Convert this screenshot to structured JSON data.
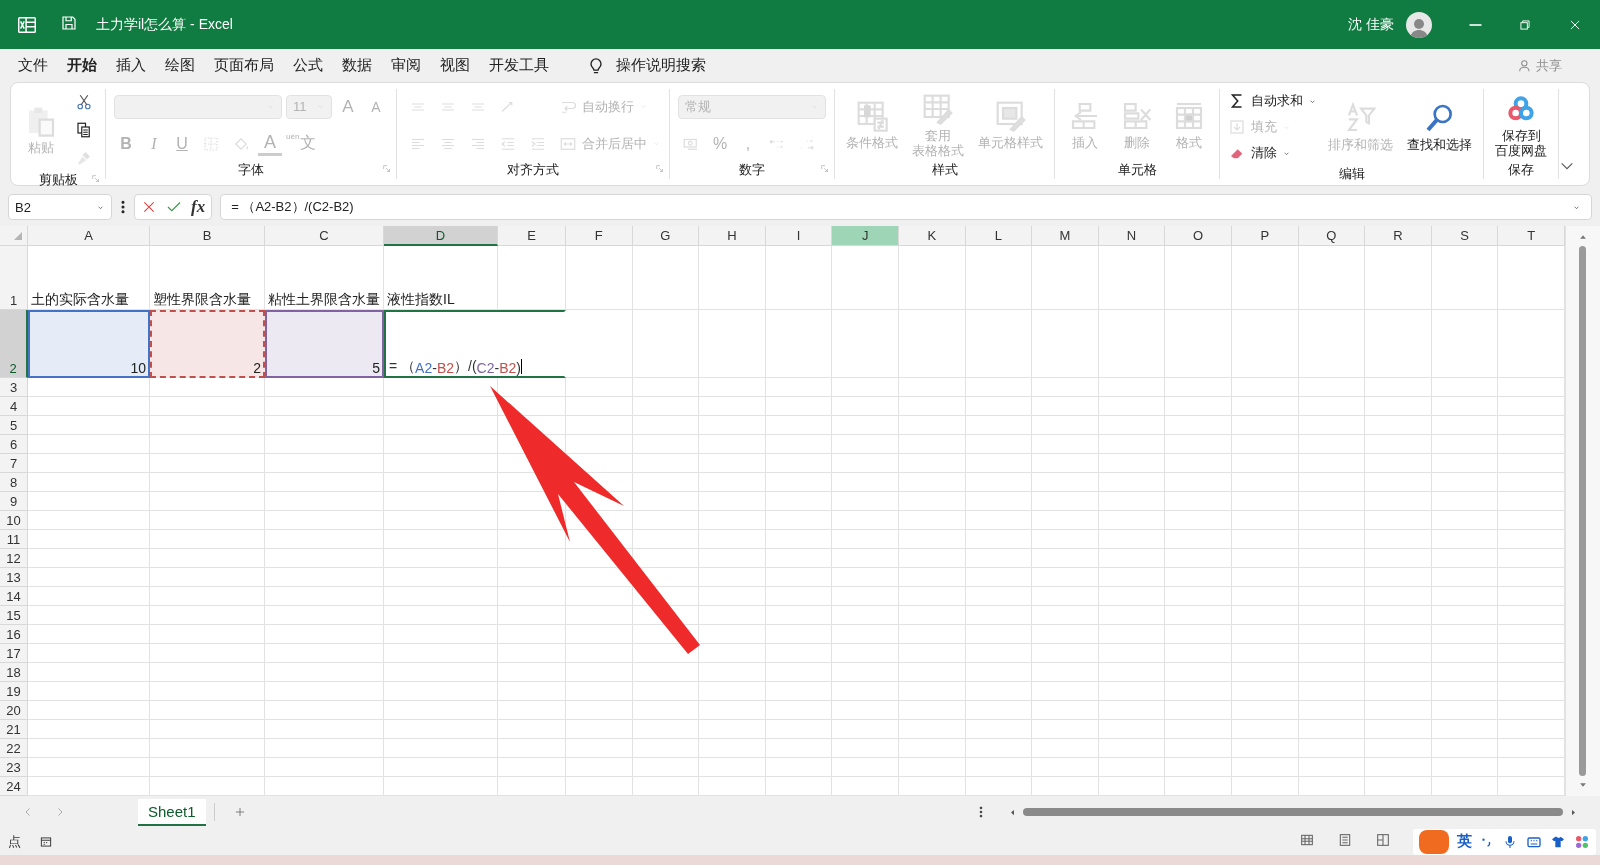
{
  "title_bar": {
    "title": "土力学il怎么算  -  Excel",
    "user": "沈 佳豪"
  },
  "menu": {
    "tabs": [
      {
        "label": "文件",
        "selected": false
      },
      {
        "label": "开始",
        "selected": true
      },
      {
        "label": "插入",
        "selected": false
      },
      {
        "label": "绘图",
        "selected": false
      },
      {
        "label": "页面布局",
        "selected": false
      },
      {
        "label": "公式",
        "selected": false
      },
      {
        "label": "数据",
        "selected": false
      },
      {
        "label": "审阅",
        "selected": false
      },
      {
        "label": "视图",
        "selected": false
      },
      {
        "label": "开发工具",
        "selected": false
      }
    ],
    "tell_me": "操作说明搜索",
    "share": "共享"
  },
  "ribbon": {
    "groups": [
      {
        "label": "剪贴板",
        "launcher": true,
        "stacks": [
          [
            {
              "kind": "paste",
              "label": "粘贴",
              "disabled": true
            }
          ],
          [
            {
              "kind": "cut",
              "disabled": false
            },
            {
              "kind": "copy",
              "disabled": false
            },
            {
              "kind": "brush",
              "disabled": true
            }
          ]
        ]
      },
      {
        "label": "字体",
        "launcher": true,
        "stacks": [
          [
            {
              "kind": "row",
              "items": [
                {
                  "kind": "fontname",
                  "value": "",
                  "disabled": true
                },
                {
                  "kind": "fontsize",
                  "value": "11",
                  "disabled": true
                },
                {
                  "kind": "grow",
                  "label": "A",
                  "disabled": true
                },
                {
                  "kind": "shrink",
                  "label": "A",
                  "disabled": true
                }
              ]
            },
            {
              "kind": "row",
              "items": [
                {
                  "kind": "bold",
                  "label": "B",
                  "disabled": true
                },
                {
                  "kind": "italic",
                  "label": "I",
                  "disabled": true
                },
                {
                  "kind": "underline",
                  "label": "U",
                  "disabled": true
                },
                {
                  "kind": "border",
                  "disabled": true
                },
                {
                  "kind": "fill",
                  "disabled": true
                },
                {
                  "kind": "fontcolor",
                  "label": "A",
                  "disabled": true
                },
                {
                  "kind": "phonetic",
                  "label": "文",
                  "ruby": "uén",
                  "disabled": true
                }
              ]
            }
          ]
        ]
      },
      {
        "label": "对齐方式",
        "launcher": true,
        "stacks": [
          [
            {
              "kind": "row",
              "items": [
                {
                  "kind": "aligntop",
                  "disabled": true
                },
                {
                  "kind": "alignmiddle",
                  "disabled": true
                },
                {
                  "kind": "alignbottom",
                  "disabled": true
                },
                {
                  "kind": "orientation",
                  "disabled": true
                }
              ]
            },
            {
              "kind": "row",
              "items": [
                {
                  "kind": "alignleft",
                  "disabled": true
                },
                {
                  "kind": "aligncenter",
                  "disabled": true
                },
                {
                  "kind": "alignright",
                  "disabled": true
                },
                {
                  "kind": "outdent",
                  "disabled": true
                },
                {
                  "kind": "indent",
                  "disabled": true
                }
              ]
            }
          ],
          [
            {
              "kind": "wrap",
              "label": "自动换行",
              "disabled": true
            },
            {
              "kind": "merge",
              "label": "合并后居中",
              "disabled": true
            }
          ]
        ]
      },
      {
        "label": "数字",
        "launcher": true,
        "stacks": [
          [
            {
              "kind": "row",
              "items": [
                {
                  "kind": "numformat",
                  "value": "常规",
                  "disabled": true
                }
              ]
            },
            {
              "kind": "row",
              "items": [
                {
                  "kind": "currency",
                  "disabled": true
                },
                {
                  "kind": "percent",
                  "label": "%",
                  "disabled": true
                },
                {
                  "kind": "comma",
                  "label": ",",
                  "disabled": true
                },
                {
                  "kind": "incdecimal",
                  "disabled": true
                },
                {
                  "kind": "decdecimal",
                  "disabled": true
                }
              ]
            }
          ]
        ]
      },
      {
        "label": "样式",
        "launcher": false,
        "stacks": [
          [
            {
              "kind": "condformat",
              "label": "条件格式",
              "disabled": true
            }
          ],
          [
            {
              "kind": "tableformat",
              "lines": [
                "套用",
                "表格格式"
              ],
              "disabled": true
            }
          ],
          [
            {
              "kind": "cellstyle",
              "label": "单元格样式",
              "disabled": true
            }
          ]
        ]
      },
      {
        "label": "单元格",
        "launcher": false,
        "stacks": [
          [
            {
              "kind": "insert",
              "label": "插入",
              "disabled": true
            }
          ],
          [
            {
              "kind": "delete",
              "label": "删除",
              "disabled": true
            }
          ],
          [
            {
              "kind": "format",
              "label": "格式",
              "disabled": true
            }
          ]
        ]
      },
      {
        "label": "编辑",
        "launcher": false,
        "stacks": [
          [
            {
              "kind": "autosum",
              "label": "自动求和",
              "disabled": false
            },
            {
              "kind": "filldown",
              "label": "填充",
              "disabled": true
            },
            {
              "kind": "clear",
              "label": "清除",
              "disabled": false
            }
          ],
          [
            {
              "kind": "sort",
              "label": "排序和筛选",
              "disabled": true
            }
          ],
          [
            {
              "kind": "find",
              "label": "查找和选择",
              "disabled": false
            }
          ]
        ]
      },
      {
        "label": "保存",
        "launcher": false,
        "stacks": [
          [
            {
              "kind": "cloud",
              "lines": [
                "保存到",
                "百度网盘"
              ],
              "disabled": false
            }
          ]
        ]
      }
    ]
  },
  "formula_bar": {
    "name_box": "B2",
    "function_label": "fx",
    "formula": "=  （A2-B2）/(C2-B2)"
  },
  "sheet": {
    "columns": [
      {
        "label": "A",
        "selected": false,
        "highlighted": false
      },
      {
        "label": "B",
        "selected": false,
        "highlighted": false
      },
      {
        "label": "C",
        "selected": false,
        "highlighted": false
      },
      {
        "label": "D",
        "selected": true,
        "highlighted": false
      },
      {
        "label": "E",
        "selected": false,
        "highlighted": false
      },
      {
        "label": "F",
        "selected": false,
        "highlighted": false
      },
      {
        "label": "G",
        "selected": false,
        "highlighted": false
      },
      {
        "label": "H",
        "selected": false,
        "highlighted": false
      },
      {
        "label": "I",
        "selected": false,
        "highlighted": false
      },
      {
        "label": "J",
        "selected": false,
        "highlighted": true
      },
      {
        "label": "K",
        "selected": false,
        "highlighted": false
      },
      {
        "label": "L",
        "selected": false,
        "highlighted": false
      },
      {
        "label": "M",
        "selected": false,
        "highlighted": false
      },
      {
        "label": "N",
        "selected": false,
        "highlighted": false
      },
      {
        "label": "O",
        "selected": false,
        "highlighted": false
      },
      {
        "label": "P",
        "selected": false,
        "highlighted": false
      },
      {
        "label": "Q",
        "selected": false,
        "highlighted": false
      },
      {
        "label": "R",
        "selected": false,
        "highlighted": false
      },
      {
        "label": "S",
        "selected": false,
        "highlighted": false
      },
      {
        "label": "T",
        "selected": false,
        "highlighted": false
      }
    ],
    "rows": [
      {
        "label": "1",
        "selected": false,
        "cells": [
          {
            "kind": "text",
            "text": "土的实际含水量"
          },
          {
            "kind": "text",
            "text": "塑性界限含水量"
          },
          {
            "kind": "text",
            "text": "粘性土界限含水量"
          },
          {
            "kind": "text",
            "text": "液性指数IL"
          }
        ]
      },
      {
        "label": "2",
        "selected": true,
        "cells": [
          {
            "kind": "reference",
            "text": "10",
            "color": "#4472c4"
          },
          {
            "kind": "pointing",
            "text": "2",
            "color": "#c0504d"
          },
          {
            "kind": "reference",
            "text": "5",
            "color": "#8064a2"
          },
          {
            "kind": "editing",
            "segments": [
              {
                "text": "= （"
              },
              {
                "text": "A2",
                "color": "#4472c4"
              },
              {
                "text": "-"
              },
              {
                "text": "B2",
                "color": "#c0504d"
              },
              {
                "text": "）/("
              },
              {
                "text": "C2",
                "color": "#8064a2"
              },
              {
                "text": "-"
              },
              {
                "text": "B2",
                "color": "#c0504d"
              },
              {
                "text": ")"
              }
            ]
          }
        ]
      },
      {
        "label": "3",
        "selected": false
      },
      {
        "label": "4",
        "selected": false
      },
      {
        "label": "5",
        "selected": false
      },
      {
        "label": "6",
        "selected": false
      },
      {
        "label": "7",
        "selected": false
      },
      {
        "label": "8",
        "selected": false
      },
      {
        "label": "9",
        "selected": false
      },
      {
        "label": "10",
        "selected": false
      },
      {
        "label": "11",
        "selected": false
      },
      {
        "label": "12",
        "selected": false
      },
      {
        "label": "13",
        "selected": false
      },
      {
        "label": "14",
        "selected": false
      },
      {
        "label": "15",
        "selected": false
      },
      {
        "label": "16",
        "selected": false
      },
      {
        "label": "17",
        "selected": false
      },
      {
        "label": "18",
        "selected": false
      },
      {
        "label": "19",
        "selected": false
      },
      {
        "label": "20",
        "selected": false
      },
      {
        "label": "21",
        "selected": false
      },
      {
        "label": "22",
        "selected": false
      },
      {
        "label": "23",
        "selected": false
      },
      {
        "label": "24",
        "selected": false
      }
    ]
  },
  "sheet_tabs": [
    {
      "label": "Sheet1",
      "selected": true
    }
  ],
  "status_bar": {
    "mode": "点",
    "ime_language": "英"
  }
}
